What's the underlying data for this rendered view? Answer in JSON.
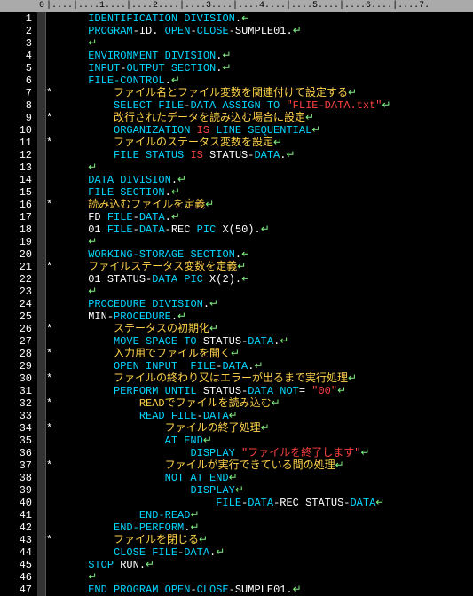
{
  "ruler": "|....|....1....|....2....|....3....|....4....|....5....|....6....|....7.",
  "origin": "0",
  "lines": [
    {
      "n": 1,
      "ind": 6,
      "seg": [
        {
          "c": "key",
          "t": "IDENTIFICATION DIVISION"
        },
        {
          "c": "id",
          "t": "."
        }
      ]
    },
    {
      "n": 2,
      "ind": 6,
      "seg": [
        {
          "c": "key",
          "t": "PROGRAM"
        },
        {
          "c": "id",
          "t": "-ID. "
        },
        {
          "c": "key",
          "t": "OPEN"
        },
        {
          "c": "id",
          "t": "-"
        },
        {
          "c": "key",
          "t": "CLOSE"
        },
        {
          "c": "id",
          "t": "-SUMPLE01."
        }
      ]
    },
    {
      "n": 3,
      "ind": 6,
      "seg": []
    },
    {
      "n": 4,
      "ind": 6,
      "seg": [
        {
          "c": "key",
          "t": "ENVIRONMENT DIVISION"
        },
        {
          "c": "id",
          "t": "."
        }
      ]
    },
    {
      "n": 5,
      "ind": 6,
      "seg": [
        {
          "c": "key",
          "t": "INPUT"
        },
        {
          "c": "id",
          "t": "-"
        },
        {
          "c": "key",
          "t": "OUTPUT SECTION"
        },
        {
          "c": "id",
          "t": "."
        }
      ]
    },
    {
      "n": 6,
      "ind": 6,
      "seg": [
        {
          "c": "key",
          "t": "FILE-CONTROL"
        },
        {
          "c": "id",
          "t": "."
        }
      ]
    },
    {
      "n": 7,
      "star": true,
      "ind": 10,
      "seg": [
        {
          "c": "com",
          "t": "ファイル名とファイル変数を関連付けて設定する"
        }
      ]
    },
    {
      "n": 8,
      "ind": 10,
      "seg": [
        {
          "c": "key",
          "t": "SELECT FILE"
        },
        {
          "c": "id",
          "t": "-"
        },
        {
          "c": "key",
          "t": "DATA ASSIGN TO "
        },
        {
          "c": "str",
          "t": "\"FLIE-DATA.txt\""
        }
      ]
    },
    {
      "n": 9,
      "star": true,
      "ind": 10,
      "seg": [
        {
          "c": "com",
          "t": "改行されたデータを読み込む場合に設定"
        }
      ]
    },
    {
      "n": 10,
      "ind": 10,
      "seg": [
        {
          "c": "key",
          "t": "ORGANIZATION "
        },
        {
          "c": "str",
          "t": "IS"
        },
        {
          "c": "key",
          "t": " LINE SEQUENTIAL"
        }
      ]
    },
    {
      "n": 11,
      "star": true,
      "ind": 10,
      "seg": [
        {
          "c": "com",
          "t": "ファイルのステータス変数を設定"
        }
      ]
    },
    {
      "n": 12,
      "ind": 10,
      "seg": [
        {
          "c": "key",
          "t": "FILE STATUS "
        },
        {
          "c": "str",
          "t": "IS"
        },
        {
          "c": "id",
          "t": " STATUS-"
        },
        {
          "c": "key",
          "t": "DATA"
        },
        {
          "c": "id",
          "t": "."
        }
      ]
    },
    {
      "n": 13,
      "ind": 6,
      "seg": []
    },
    {
      "n": 14,
      "ind": 6,
      "seg": [
        {
          "c": "key",
          "t": "DATA DIVISION"
        },
        {
          "c": "id",
          "t": "."
        }
      ]
    },
    {
      "n": 15,
      "ind": 6,
      "seg": [
        {
          "c": "key",
          "t": "FILE SECTION"
        },
        {
          "c": "id",
          "t": "."
        }
      ]
    },
    {
      "n": 16,
      "star": true,
      "ind": 6,
      "seg": [
        {
          "c": "com",
          "t": "読み込むファイルを定義"
        }
      ]
    },
    {
      "n": 17,
      "ind": 6,
      "seg": [
        {
          "c": "id",
          "t": "FD "
        },
        {
          "c": "key",
          "t": "FILE"
        },
        {
          "c": "id",
          "t": "-"
        },
        {
          "c": "key",
          "t": "DATA"
        },
        {
          "c": "id",
          "t": "."
        }
      ]
    },
    {
      "n": 18,
      "ind": 6,
      "seg": [
        {
          "c": "id",
          "t": "01 "
        },
        {
          "c": "key",
          "t": "FILE"
        },
        {
          "c": "id",
          "t": "-"
        },
        {
          "c": "key",
          "t": "DATA"
        },
        {
          "c": "id",
          "t": "-REC "
        },
        {
          "c": "key",
          "t": "PIC"
        },
        {
          "c": "id",
          "t": " X(50)."
        }
      ]
    },
    {
      "n": 19,
      "ind": 6,
      "seg": []
    },
    {
      "n": 20,
      "ind": 6,
      "seg": [
        {
          "c": "key",
          "t": "WORKING-STORAGE SECTION"
        },
        {
          "c": "id",
          "t": "."
        }
      ]
    },
    {
      "n": 21,
      "star": true,
      "ind": 6,
      "seg": [
        {
          "c": "com",
          "t": "ファイルステータス変数を定義"
        }
      ]
    },
    {
      "n": 22,
      "ind": 6,
      "seg": [
        {
          "c": "id",
          "t": "01 STATUS-"
        },
        {
          "c": "key",
          "t": "DATA PIC"
        },
        {
          "c": "id",
          "t": " X(2)."
        }
      ]
    },
    {
      "n": 23,
      "ind": 6,
      "seg": []
    },
    {
      "n": 24,
      "ind": 6,
      "seg": [
        {
          "c": "key",
          "t": "PROCEDURE DIVISION"
        },
        {
          "c": "id",
          "t": "."
        }
      ]
    },
    {
      "n": 25,
      "ind": 6,
      "seg": [
        {
          "c": "id",
          "t": "MIN-"
        },
        {
          "c": "key",
          "t": "PROCEDURE"
        },
        {
          "c": "id",
          "t": "."
        }
      ]
    },
    {
      "n": 26,
      "star": true,
      "ind": 10,
      "seg": [
        {
          "c": "com",
          "t": "ステータスの初期化"
        }
      ]
    },
    {
      "n": 27,
      "ind": 10,
      "seg": [
        {
          "c": "key",
          "t": "MOVE SPACE TO"
        },
        {
          "c": "id",
          "t": " STATUS-"
        },
        {
          "c": "key",
          "t": "DATA"
        },
        {
          "c": "id",
          "t": "."
        }
      ]
    },
    {
      "n": 28,
      "star": true,
      "ind": 10,
      "seg": [
        {
          "c": "com",
          "t": "入力用でファイルを開く"
        }
      ]
    },
    {
      "n": 29,
      "ind": 10,
      "seg": [
        {
          "c": "key",
          "t": "OPEN INPUT  FILE"
        },
        {
          "c": "id",
          "t": "-"
        },
        {
          "c": "key",
          "t": "DATA"
        },
        {
          "c": "id",
          "t": "."
        }
      ]
    },
    {
      "n": 30,
      "star": true,
      "ind": 10,
      "seg": [
        {
          "c": "com",
          "t": "ファイルの終わり又はエラーが出るまで実行処理"
        }
      ]
    },
    {
      "n": 31,
      "ind": 10,
      "seg": [
        {
          "c": "key",
          "t": "PERFORM UNTIL"
        },
        {
          "c": "id",
          "t": " STATUS-"
        },
        {
          "c": "key",
          "t": "DATA NOT"
        },
        {
          "c": "id",
          "t": "= "
        },
        {
          "c": "str",
          "t": "\"00\""
        }
      ]
    },
    {
      "n": 32,
      "star": true,
      "ind": 14,
      "seg": [
        {
          "c": "com",
          "t": "READでファイルを読み込む"
        }
      ]
    },
    {
      "n": 33,
      "ind": 14,
      "seg": [
        {
          "c": "key",
          "t": "READ FILE"
        },
        {
          "c": "id",
          "t": "-"
        },
        {
          "c": "key",
          "t": "DATA"
        }
      ]
    },
    {
      "n": 34,
      "star": true,
      "ind": 18,
      "seg": [
        {
          "c": "com",
          "t": "ファイルの終了処理"
        }
      ]
    },
    {
      "n": 35,
      "ind": 18,
      "seg": [
        {
          "c": "key",
          "t": "AT END"
        }
      ]
    },
    {
      "n": 36,
      "ind": 22,
      "seg": [
        {
          "c": "key",
          "t": "DISPLAY "
        },
        {
          "c": "str",
          "t": "\"ファイルを終了します\""
        }
      ]
    },
    {
      "n": 37,
      "star": true,
      "ind": 18,
      "seg": [
        {
          "c": "com",
          "t": "ファイルが実行できている間の処理"
        }
      ]
    },
    {
      "n": 38,
      "ind": 18,
      "seg": [
        {
          "c": "key",
          "t": "NOT AT END"
        }
      ]
    },
    {
      "n": 39,
      "ind": 22,
      "seg": [
        {
          "c": "key",
          "t": "DISPLAY"
        }
      ]
    },
    {
      "n": 40,
      "ind": 26,
      "seg": [
        {
          "c": "key",
          "t": "FILE"
        },
        {
          "c": "id",
          "t": "-"
        },
        {
          "c": "key",
          "t": "DATA"
        },
        {
          "c": "id",
          "t": "-REC STATUS-"
        },
        {
          "c": "key",
          "t": "DATA"
        }
      ]
    },
    {
      "n": 41,
      "ind": 14,
      "seg": [
        {
          "c": "key",
          "t": "END-READ"
        }
      ]
    },
    {
      "n": 42,
      "ind": 10,
      "seg": [
        {
          "c": "key",
          "t": "END-PERFORM"
        },
        {
          "c": "id",
          "t": "."
        }
      ]
    },
    {
      "n": 43,
      "star": true,
      "ind": 10,
      "seg": [
        {
          "c": "com",
          "t": "ファイルを閉じる"
        }
      ]
    },
    {
      "n": 44,
      "ind": 10,
      "seg": [
        {
          "c": "key",
          "t": "CLOSE FILE"
        },
        {
          "c": "id",
          "t": "-"
        },
        {
          "c": "key",
          "t": "DATA"
        },
        {
          "c": "id",
          "t": "."
        }
      ]
    },
    {
      "n": 45,
      "ind": 6,
      "seg": [
        {
          "c": "key",
          "t": "STOP"
        },
        {
          "c": "id",
          "t": " RUN."
        }
      ]
    },
    {
      "n": 46,
      "ind": 6,
      "seg": []
    },
    {
      "n": 47,
      "ind": 6,
      "seg": [
        {
          "c": "key",
          "t": "END PROGRAM OPEN"
        },
        {
          "c": "id",
          "t": "-"
        },
        {
          "c": "key",
          "t": "CLOSE"
        },
        {
          "c": "id",
          "t": "-SUMPLE01."
        }
      ]
    }
  ],
  "return_mark": "↵"
}
